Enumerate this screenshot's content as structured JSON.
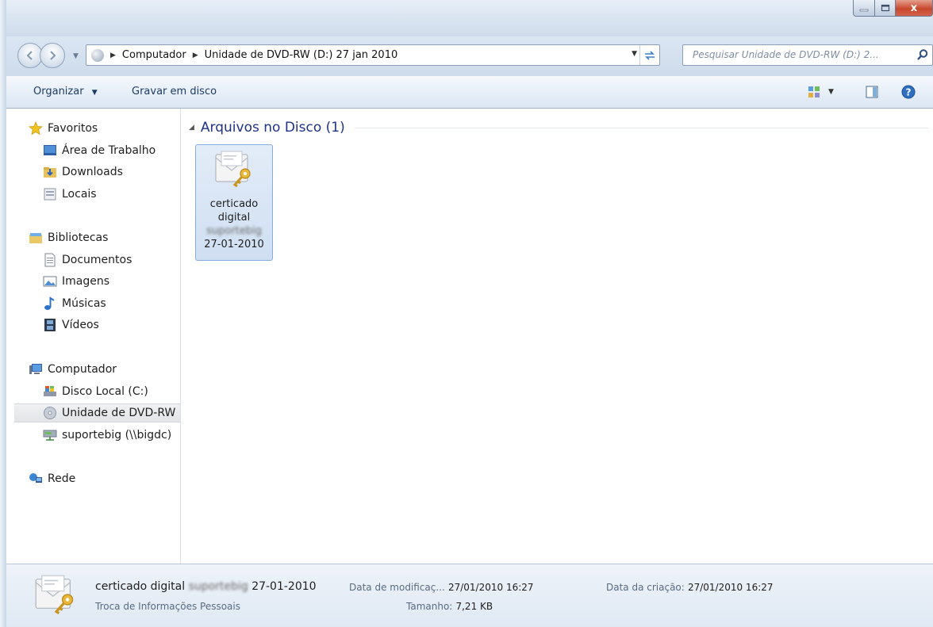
{
  "window": {
    "minimize_glyph": "–",
    "maximize_glyph": "▫",
    "close_glyph": "x"
  },
  "address": {
    "segments": [
      "Computador",
      "Unidade de DVD-RW (D:) 27 jan 2010"
    ],
    "search_placeholder": "Pesquisar Unidade de DVD-RW (D:) 2..."
  },
  "toolbar": {
    "organize_label": "Organizar",
    "burn_label": "Gravar em disco"
  },
  "sidebar": {
    "favorites": {
      "label": "Favoritos",
      "icon": "star-icon"
    },
    "favorites_items": [
      {
        "label": "Área de Trabalho",
        "icon": "desktop-icon"
      },
      {
        "label": "Downloads",
        "icon": "downloads-folder-icon"
      },
      {
        "label": "Locais",
        "icon": "recent-places-icon"
      }
    ],
    "libraries": {
      "label": "Bibliotecas",
      "icon": "libraries-icon"
    },
    "libraries_items": [
      {
        "label": "Documentos",
        "icon": "document-icon"
      },
      {
        "label": "Imagens",
        "icon": "image-icon"
      },
      {
        "label": "Músicas",
        "icon": "music-icon"
      },
      {
        "label": "Vídeos",
        "icon": "video-icon"
      }
    ],
    "computer": {
      "label": "Computador",
      "icon": "computer-icon"
    },
    "computer_items": [
      {
        "label": "Disco Local (C:)",
        "icon": "local-disk-icon"
      },
      {
        "label": "Unidade de DVD-RW",
        "icon": "dvd-drive-icon"
      },
      {
        "label": "suportebig (\\\\bigdc)",
        "icon": "network-drive-icon"
      }
    ],
    "network": {
      "label": "Rede",
      "icon": "network-icon"
    }
  },
  "content": {
    "group_title": "Arquivos no Disco (1)",
    "file": {
      "line1": "certicado",
      "line2": "digital",
      "line3_obscured": "suportebig",
      "line4": "27-01-2010",
      "icon": "certificate-key-icon"
    }
  },
  "details": {
    "name_prefix": "certicado digital",
    "name_obscured": "suportebig",
    "name_suffix": "27-01-2010",
    "type": "Troca de Informações Pessoais",
    "modified_label": "Data de modificaç...",
    "modified_value": "27/01/2010 16:27",
    "size_label": "Tamanho:",
    "size_value": "7,21 KB",
    "created_label": "Data da criação:",
    "created_value": "27/01/2010 16:27"
  },
  "colors": {
    "accent_blue": "#1e3287",
    "selection_border": "#84acdd",
    "close_red": "#c8482e"
  }
}
